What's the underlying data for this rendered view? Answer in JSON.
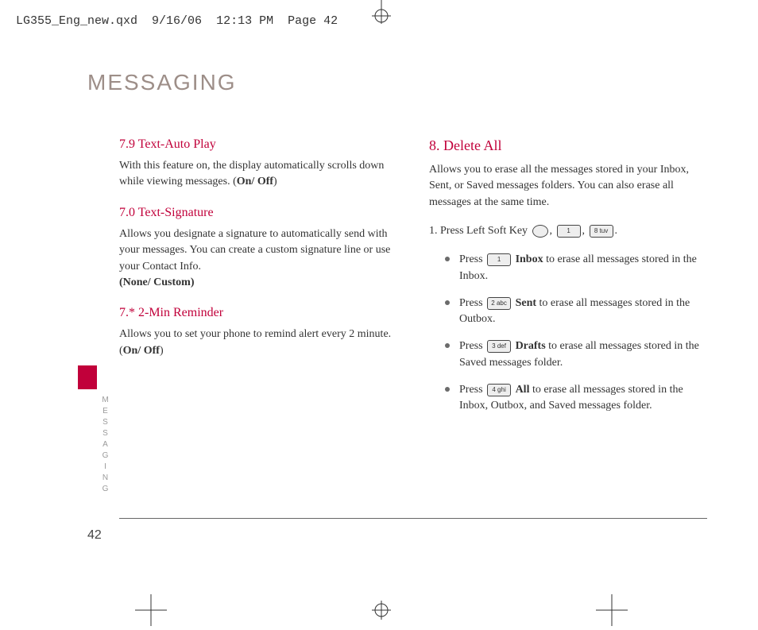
{
  "header": {
    "file": "LG355_Eng_new.qxd",
    "date": "9/16/06",
    "time": "12:13 PM",
    "page_label": "Page 42"
  },
  "page_title": "MESSAGING",
  "side_label": "MESSAGING",
  "page_number": "42",
  "left": {
    "s1": {
      "title": "7.9 Text-Auto Play",
      "body_a": "With this feature on, the display automatically scrolls down while viewing messages. (",
      "opt": "On/ Off",
      "body_b": ")"
    },
    "s2": {
      "title": "7.0 Text-Signature",
      "body": "Allows you designate a signature to automatically send with your messages. You can create a custom signature line or use your Contact Info.",
      "opt": "(None/ Custom)"
    },
    "s3": {
      "title": "7.* 2-Min Reminder",
      "body_a": "Allows you to set your phone to remind alert every 2 minute. (",
      "opt": "On/ Off",
      "body_b": ")"
    }
  },
  "right": {
    "title": "8. Delete All",
    "intro": "Allows you to erase all the messages stored in your Inbox, Sent, or Saved messages folders. You can also erase all messages at the same time.",
    "step_prefix": "1. Press Left Soft Key ",
    "key1": "1",
    "key8": "8 tuv",
    "bullets": {
      "b1_a": "Press ",
      "b1_key": "1",
      "b1_bold": "Inbox",
      "b1_b": " to erase all messages stored in the Inbox.",
      "b2_a": "Press ",
      "b2_key": "2 abc",
      "b2_bold": "Sent",
      "b2_b": " to erase all messages stored in the Outbox.",
      "b3_a": "Press ",
      "b3_key": "3 def",
      "b3_bold": "Drafts",
      "b3_b": " to erase all messages stored in the Saved messages folder.",
      "b4_a": "Press ",
      "b4_key": "4 ghi",
      "b4_bold": "All",
      "b4_b": " to erase all messages stored in the Inbox, Outbox, and Saved messages folder."
    }
  }
}
